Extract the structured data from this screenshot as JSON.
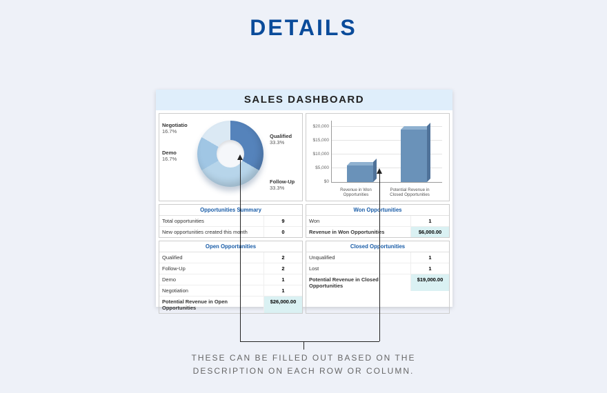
{
  "page_title": "DETAILS",
  "dashboard_title": "SALES DASHBOARD",
  "caption_line1": "THESE CAN BE FILLED OUT BASED ON THE",
  "caption_line2": "DESCRIPTION ON EACH ROW OR COLUMN.",
  "donut_labels": {
    "negotiation_name": "Negotiatio",
    "negotiation_pct": "16.7%",
    "demo_name": "Demo",
    "demo_pct": "16.7%",
    "qualified_name": "Qualified",
    "qualified_pct": "33.3%",
    "followup_name": "Follow-Up",
    "followup_pct": "33.3%"
  },
  "bar_ticks": {
    "t0": "$0",
    "t1": "$5,000",
    "t2": "$10,000",
    "t3": "$15,000",
    "t4": "$20,000"
  },
  "bar_xlabels": {
    "x1": "Revenue in Won Opportunities",
    "x2": "Potential Revenue in Closed Opportunities"
  },
  "tables": {
    "opp_summary": {
      "title": "Opportunities Summary",
      "r1_label": "Total opportunities",
      "r1_val": "9",
      "r2_label": "New opportunities created this month",
      "r2_val": "0"
    },
    "won": {
      "title": "Won Opportunities",
      "r1_label": "Won",
      "r1_val": "1",
      "r2_label": "Revenue in Won Opportunities",
      "r2_val": "$6,000.00"
    },
    "open": {
      "title": "Open Opportunities",
      "r1_label": "Qualified",
      "r1_val": "2",
      "r2_label": "Follow-Up",
      "r2_val": "2",
      "r3_label": "Demo",
      "r3_val": "1",
      "r4_label": "Negotiation",
      "r4_val": "1",
      "r5_label": "Potential Revenue in Open Opportunities",
      "r5_val": "$26,000.00"
    },
    "closed": {
      "title": "Closed Opportunities",
      "r1_label": "Unqualified",
      "r1_val": "1",
      "r2_label": "Lost",
      "r2_val": "1",
      "r3_label": "Potential Revenue in Closed Opportunities",
      "r3_val": "$19,000.00"
    }
  },
  "chart_data": [
    {
      "type": "pie",
      "title": "",
      "series": [
        {
          "name": "Qualified",
          "value": 33.3
        },
        {
          "name": "Follow-Up",
          "value": 33.3
        },
        {
          "name": "Demo",
          "value": 16.7
        },
        {
          "name": "Negotiation",
          "value": 16.7
        }
      ]
    },
    {
      "type": "bar",
      "categories": [
        "Revenue in Won Opportunities",
        "Potential Revenue in Closed Opportunities"
      ],
      "values": [
        6000,
        19000
      ],
      "ylim": [
        0,
        20000
      ],
      "ylabel": "",
      "xlabel": "",
      "title": ""
    }
  ]
}
